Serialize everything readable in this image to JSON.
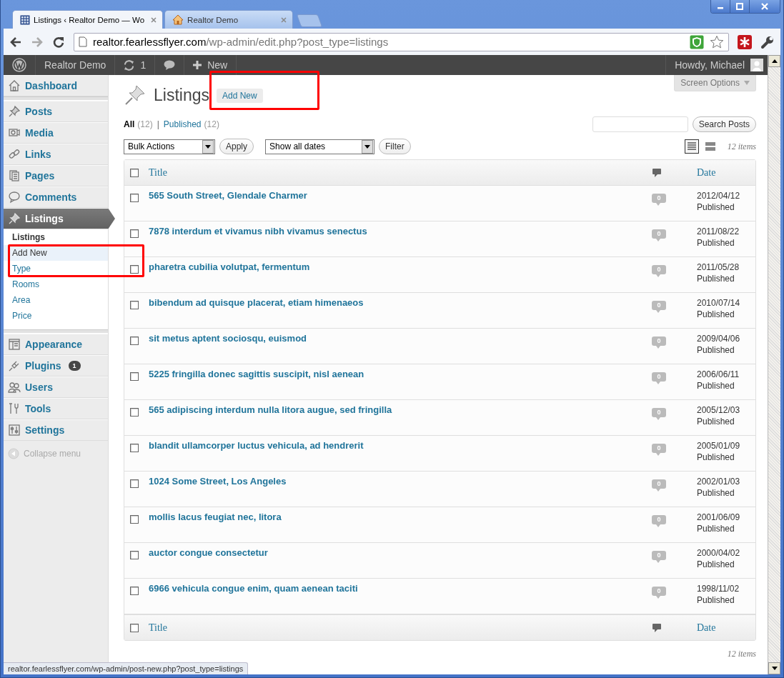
{
  "browser": {
    "tabs": [
      {
        "title": "Listings ‹ Realtor Demo — Wo",
        "selected": true
      },
      {
        "title": "Realtor Demo",
        "selected": false
      }
    ],
    "address": {
      "host": "realtor.fearlessflyer.com",
      "path": "/wp-admin/edit.php?post_type=listings"
    }
  },
  "admin_bar": {
    "site": "Realtor Demo",
    "updates": "1",
    "new": "New",
    "greeting": "Howdy, Michael"
  },
  "sidebar": {
    "items": [
      {
        "label": "Dashboard",
        "selected": false,
        "group_start": false
      },
      {
        "label": "Posts",
        "selected": false,
        "group_start": true
      },
      {
        "label": "Media",
        "selected": false,
        "group_start": false
      },
      {
        "label": "Links",
        "selected": false,
        "group_start": false
      },
      {
        "label": "Pages",
        "selected": false,
        "group_start": false
      },
      {
        "label": "Comments",
        "selected": false,
        "group_start": false
      },
      {
        "label": "Listings",
        "selected": true,
        "group_start": false,
        "children": [
          {
            "label": "Listings",
            "selected": true,
            "hovered": false
          },
          {
            "label": "Add New",
            "selected": false,
            "hovered": true
          },
          {
            "label": "Type",
            "selected": false,
            "hovered": false
          },
          {
            "label": "Rooms",
            "selected": false,
            "hovered": false
          },
          {
            "label": "Area",
            "selected": false,
            "hovered": false
          },
          {
            "label": "Price",
            "selected": false,
            "hovered": false
          }
        ]
      },
      {
        "label": "Appearance",
        "selected": false,
        "group_start": true
      },
      {
        "label": "Plugins",
        "selected": false,
        "group_start": false,
        "badge": "1"
      },
      {
        "label": "Users",
        "selected": false,
        "group_start": false
      },
      {
        "label": "Tools",
        "selected": false,
        "group_start": false
      },
      {
        "label": "Settings",
        "selected": false,
        "group_start": false
      }
    ],
    "collapse": "Collapse menu"
  },
  "page": {
    "title": "Listings",
    "add_new": "Add New",
    "screen_options": "Screen Options",
    "views": [
      {
        "label": "All",
        "count": "(12)",
        "selected": true
      },
      {
        "label": "Published",
        "count": "(12)",
        "selected": false
      }
    ],
    "views_separator": "|",
    "search_button": "Search Posts",
    "bulk_actions": "Bulk Actions",
    "apply": "Apply",
    "dates": "Show all dates",
    "filter": "Filter",
    "view_modes": [
      {
        "kind": "list",
        "selected": true
      },
      {
        "kind": "excerpt",
        "selected": false
      }
    ],
    "items_count": "12 items",
    "table": {
      "columns": [
        "Title",
        "Date"
      ],
      "footer_columns": [
        "Title",
        "Date"
      ],
      "select_all_checked": false,
      "footer_select_all_checked": false,
      "rows": [
        {
          "title": "565 South Street, Glendale Charmer",
          "comments": "0",
          "date": "2012/04/12",
          "status": "Published",
          "checked": false
        },
        {
          "title": "7878 interdum et vivamus nibh vivamus senectus",
          "comments": "0",
          "date": "2011/08/22",
          "status": "Published",
          "checked": false
        },
        {
          "title": "pharetra cubilia volutpat, fermentum",
          "comments": "0",
          "date": "2011/05/28",
          "status": "Published",
          "checked": false
        },
        {
          "title": "bibendum ad quisque placerat, etiam himenaeos",
          "comments": "0",
          "date": "2010/07/14",
          "status": "Published",
          "checked": false
        },
        {
          "title": "sit metus aptent sociosqu, euismod",
          "comments": "0",
          "date": "2009/04/06",
          "status": "Published",
          "checked": false
        },
        {
          "title": "5225 fringilla donec sagittis suscipit, nisl aenean",
          "comments": "0",
          "date": "2006/06/11",
          "status": "Published",
          "checked": false
        },
        {
          "title": "565 adipiscing interdum nulla litora augue, sed fringilla",
          "comments": "0",
          "date": "2005/12/03",
          "status": "Published",
          "checked": false
        },
        {
          "title": "blandit ullamcorper luctus vehicula, ad hendrerit",
          "comments": "0",
          "date": "2005/01/09",
          "status": "Published",
          "checked": false
        },
        {
          "title": "1024 Some Street, Los Angeles",
          "comments": "0",
          "date": "2002/01/03",
          "status": "Published",
          "checked": false
        },
        {
          "title": "mollis lacus feugiat nec, litora",
          "comments": "0",
          "date": "2001/06/09",
          "status": "Published",
          "checked": false
        },
        {
          "title": "auctor congue consectetur",
          "comments": "0",
          "date": "2000/04/02",
          "status": "Published",
          "checked": false
        },
        {
          "title": "6966 vehicula congue enim, quam aenean taciti",
          "comments": "0",
          "date": "1998/11/02",
          "status": "Published",
          "checked": false
        }
      ]
    },
    "footer_count": "12 items"
  },
  "status_bar": "realtor.fearlessflyer.com/wp-admin/post-new.php?post_type=listings"
}
